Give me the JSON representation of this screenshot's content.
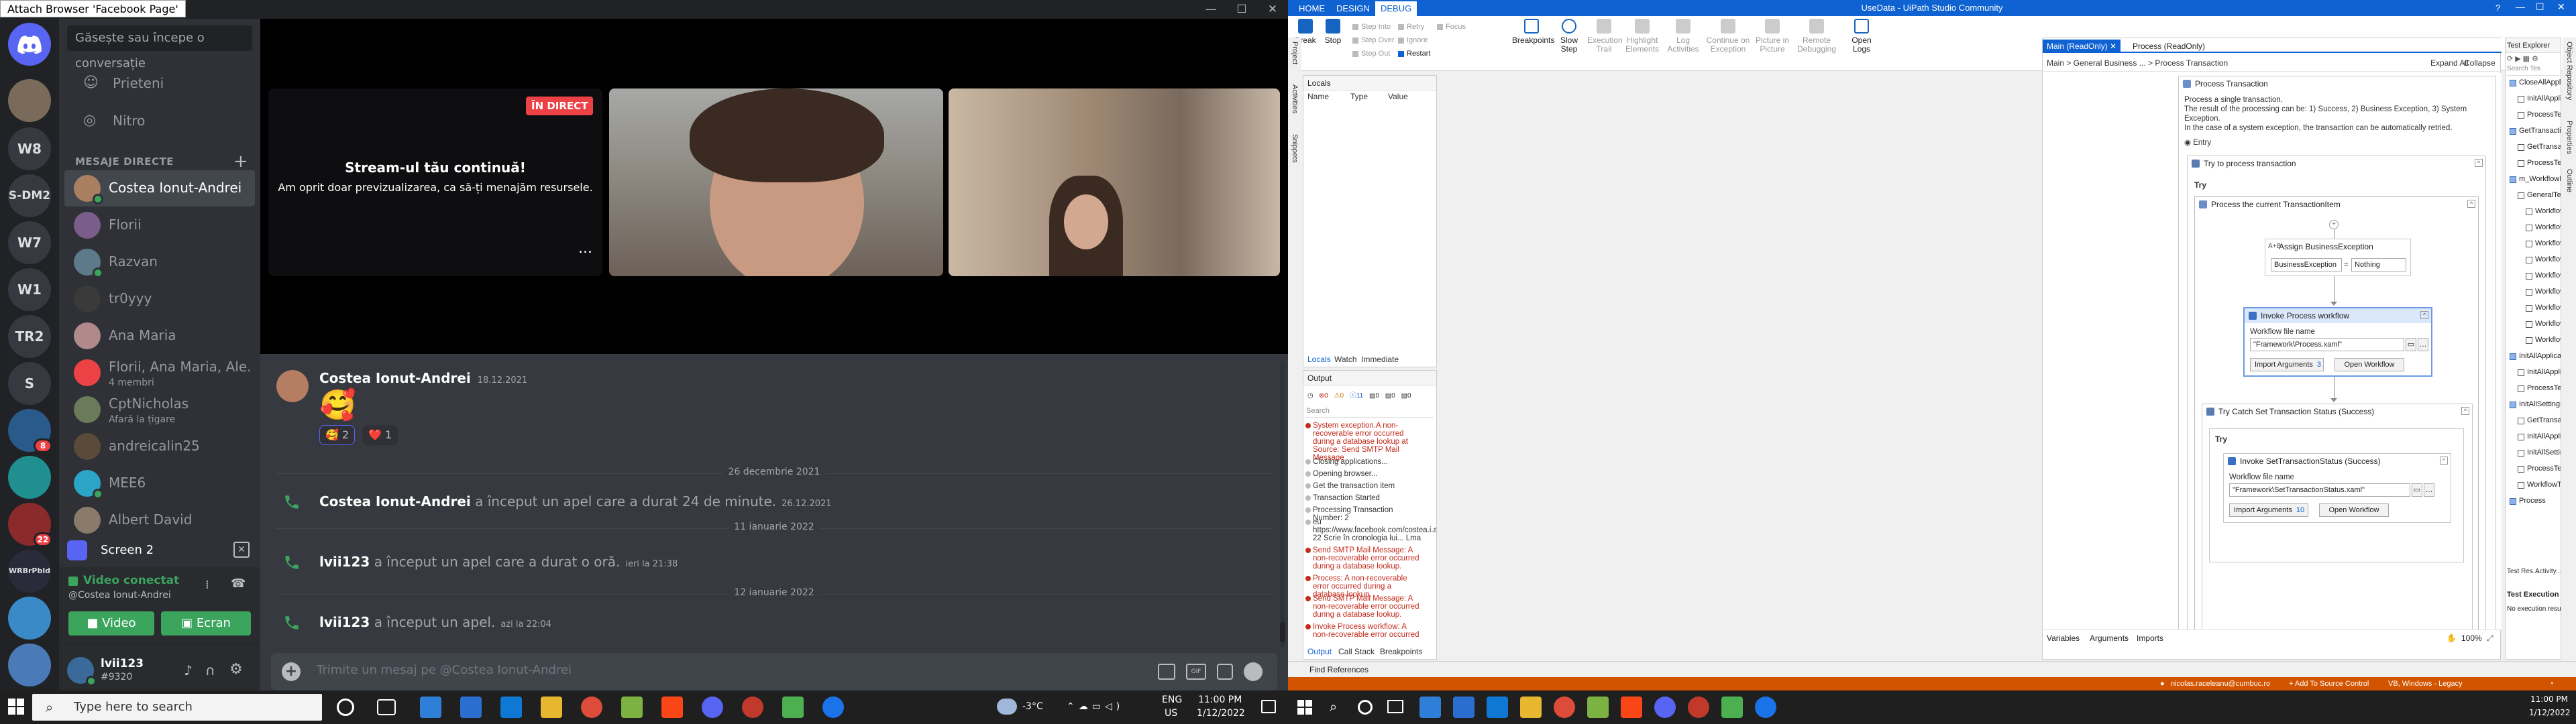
{
  "left_monitor": {
    "attach_badge": "Attach Browser 'Facebook Page'",
    "guilds": [
      {
        "label": "",
        "icon": "discord-logo-icon"
      },
      {
        "label": "",
        "icon": "server-avatar"
      },
      {
        "label": "W8"
      },
      {
        "label": "S-DM2"
      },
      {
        "label": "W7"
      },
      {
        "label": "W1"
      },
      {
        "label": "TR2"
      },
      {
        "label": "S"
      },
      {
        "label": "",
        "badge": "8"
      },
      {
        "label": "",
        "icon": "server-avatar"
      },
      {
        "label": "",
        "badge": "22"
      },
      {
        "label": "WRBrPbld"
      },
      {
        "label": "",
        "icon": "server-avatar"
      },
      {
        "label": "",
        "icon": "server-avatar"
      }
    ],
    "search_placeholder": "Găsește sau începe o conversație",
    "nav": {
      "friends": "Prieteni",
      "nitro": "Nitro"
    },
    "dm_header": "MESAJE DIRECTE",
    "dms": [
      {
        "name": "Costea Ionut-Andrei",
        "sub": "",
        "active": true,
        "color": "#a97f61"
      },
      {
        "name": "Florii",
        "sub": "",
        "color": "#7a5d8a"
      },
      {
        "name": "Razvan",
        "sub": "",
        "color": "#5c7a8a"
      },
      {
        "name": "tr0yyy",
        "sub": "",
        "color": "#3a3a3a"
      },
      {
        "name": "Ana Maria",
        "sub": "",
        "color": "#b08a8a"
      },
      {
        "name": "Florii, Ana Maria, Ale...",
        "sub": "4 membri",
        "color": "#ed4245"
      },
      {
        "name": "CptNicholas",
        "sub": "Afară la țigare",
        "color": "#6b7a5a"
      },
      {
        "name": "andreicalin25",
        "sub": "",
        "color": "#5a4a3a"
      },
      {
        "name": "MEE6",
        "sub": "",
        "color": "#2aa5c7"
      },
      {
        "name": "Albert David",
        "sub": "",
        "color": "#8a7a6a"
      }
    ],
    "screen_share_label": "Screen 2",
    "voice": {
      "status": "Video conectat",
      "channel": "@Costea Ionut-Andrei",
      "video_btn": "Video",
      "screen_btn": "Ecran"
    },
    "user": {
      "name": "lvii123",
      "tag": "#9320"
    },
    "stream": {
      "live": "ÎN DIRECT",
      "title": "Stream-ul tău continuă!",
      "subtitle": "Am oprit doar previzualizarea, ca să-ți menajăm resursele.",
      "more": "..."
    },
    "messages": {
      "m1_author": "Costea Ionut-Andrei",
      "m1_time": "18.12.2021",
      "m1_emoji": "🥰",
      "reaction1": "🥰 2",
      "reaction2": "❤️ 1",
      "divider1": "26 decembrie 2021",
      "call1_author": "Costea Ionut-Andrei",
      "call1_text": " a început un apel care a durat 24 de minute.",
      "call1_time": "26.12.2021",
      "divider2": "11 ianuarie 2022",
      "call2_author": "lvii123",
      "call2_text": " a început un apel care a durat o oră.",
      "call2_time": "ieri la 21:38",
      "divider3": "12 ianuarie 2022",
      "call3_author": "lvii123",
      "call3_text": " a început un apel.",
      "call3_time": "azi la 22:04"
    },
    "composer_placeholder": "Trimite un mesaj pe @Costea Ionut-Andrei",
    "taskbar": {
      "search": "Type here to search",
      "weather": "-3°C",
      "lang": "ENG",
      "layout": "US",
      "time": "11:00 PM",
      "date": "1/12/2022"
    }
  },
  "right_monitor": {
    "title": "UseData - UiPath Studio Community",
    "menu_tabs": [
      "HOME",
      "DESIGN",
      "DEBUG"
    ],
    "ribbon": {
      "break": "Break",
      "stop": "Stop",
      "step_into": "Step Into",
      "step_over": "Step Over",
      "step_out": "Step Out",
      "retry": "Retry",
      "ignore": "Ignore",
      "restart": "Restart",
      "focus": "Focus",
      "breakpoints": "Breakpoints",
      "slow_step": "Slow Step",
      "execution_trail": "Execution Trail",
      "highlight_elements": "Highlight Elements",
      "log_activities": "Log Activities",
      "continue_on_exception": "Continue on Exception",
      "picture_in_picture": "Picture in Picture",
      "remote_debugging": "Remote Debugging",
      "open_logs": "Open Logs"
    },
    "left_vtabs": [
      "Project",
      "Activities",
      "Snippets"
    ],
    "locals": {
      "title": "Locals",
      "cols": [
        "Name",
        "Type",
        "Value"
      ],
      "tabs": [
        "Locals",
        "Watch",
        "Immediate"
      ]
    },
    "output": {
      "title": "Output",
      "counts": [
        "0",
        "0",
        "11",
        "0",
        "0",
        "0"
      ],
      "search": "Search",
      "lines": [
        {
          "t": "System exception.A non-recoverable error occurred during a database lookup at Source: Send SMTP Mail Message",
          "err": true
        },
        {
          "t": "Closing applications...",
          "err": false
        },
        {
          "t": "Opening browser...",
          "err": false
        },
        {
          "t": "Get the transaction item",
          "err": false
        },
        {
          "t": "Transaction Started",
          "err": false
        },
        {
          "t": "Processing Transaction Number: 2",
          "err": false
        },
        {
          "t": "eu https://www.facebook.com/costea.i.andrei 22 Scrie în cronologia lui... Lma",
          "err": false
        },
        {
          "t": "Send SMTP Mail Message: A non-recoverable error occurred during a database lookup.",
          "err": true
        },
        {
          "t": "Process: A non-recoverable error occurred during a database lookup.",
          "err": true
        },
        {
          "t": "Send SMTP Mail Message: A non-recoverable error occurred during a database lookup.",
          "err": true
        },
        {
          "t": "Invoke Process workflow: A non-recoverable error occurred during a database lookup.",
          "err": true
        }
      ],
      "tabs": [
        "Output",
        "Call Stack",
        "Breakpoints"
      ]
    },
    "designer": {
      "tabs": [
        "Main (ReadOnly)",
        "Process (ReadOnly)"
      ],
      "crumb": "Main  >  General Business ...  >  Process Transaction",
      "expand_all": "Expand All",
      "collapse_all": "Collapse All",
      "seq_title": "Process Transaction",
      "annotation": [
        "Process a single transaction.",
        "The result of the processing can be: 1) Success, 2) Business Exception, 3) System Exception.",
        "In the case of a system exception, the transaction can be automatically retried."
      ],
      "entry": "Entry",
      "try_catch": "Try to process transaction",
      "try": "Try",
      "seq_current": "Process the current TransactionItem",
      "assign_title": "Assign BusinessException",
      "assign_left": "BusinessException",
      "assign_right": "Nothing",
      "invoke1_title": "Invoke Process workflow",
      "wf_label": "Workflow file name",
      "invoke1_path": "\"Framework\\Process.xaml\"",
      "import_args": "Import Arguments",
      "import1_count": "3",
      "open_wf": "Open Workflow",
      "try_catch2": "Try Catch Set Transaction Status (Success)",
      "try2": "Try",
      "invoke2_title": "Invoke SetTransactionStatus (Success)",
      "invoke2_path": "\"Framework\\SetTransactionStatus.xaml\"",
      "import2_count": "10",
      "bottom_tabs": [
        "Variables",
        "Arguments",
        "Imports"
      ],
      "zoom": "100%"
    },
    "test_explorer": {
      "title": "Test Explorer",
      "search": "Search Tes",
      "items": [
        {
          "t": "CloseAllApplications",
          "lvl": 0,
          "grp": true
        },
        {
          "t": "InitAllApplications",
          "lvl": 1
        },
        {
          "t": "ProcessTestCase",
          "lvl": 1
        },
        {
          "t": "GetTransactionData",
          "lvl": 0,
          "grp": true
        },
        {
          "t": "GetTransactionDa",
          "lvl": 1
        },
        {
          "t": "ProcessTestCase",
          "lvl": 1
        },
        {
          "t": "m_WorkflowFile",
          "lvl": 0,
          "grp": true
        },
        {
          "t": "GeneralTestCase",
          "lvl": 1
        },
        {
          "t": "WorkflowFile",
          "lvl": 2
        },
        {
          "t": "WorkflowFile",
          "lvl": 2
        },
        {
          "t": "WorkflowFile",
          "lvl": 2
        },
        {
          "t": "WorkflowFile",
          "lvl": 2
        },
        {
          "t": "WorkflowFile",
          "lvl": 2
        },
        {
          "t": "WorkflowFile",
          "lvl": 2
        },
        {
          "t": "WorkflowFile",
          "lvl": 2
        },
        {
          "t": "WorkflowFile",
          "lvl": 2
        },
        {
          "t": "WorkflowFile",
          "lvl": 2
        },
        {
          "t": "InitAllApplications",
          "lvl": 0,
          "grp": true
        },
        {
          "t": "InitAllApplications",
          "lvl": 1
        },
        {
          "t": "ProcessTestCase",
          "lvl": 1
        },
        {
          "t": "InitAllSettings",
          "lvl": 0,
          "grp": true
        },
        {
          "t": "GetTransactionDa",
          "lvl": 1
        },
        {
          "t": "InitAllApplications",
          "lvl": 1
        },
        {
          "t": "InitAllSettingsTest",
          "lvl": 1
        },
        {
          "t": "ProcessTestCase",
          "lvl": 1
        },
        {
          "t": "WorkflowTestCase",
          "lvl": 1
        },
        {
          "t": "Process",
          "lvl": 0,
          "grp": true
        }
      ],
      "bottom_tabs": [
        "Test Res...",
        "Activity..."
      ],
      "results_title": "Test Execution Results",
      "results_text": "No execution results availab"
    },
    "right_vtabs": [
      "Object Repository",
      "Properties",
      "Outline"
    ],
    "find_refs": "Find References",
    "status": {
      "user": "nicolas.raceleanu@cumbuc.ro",
      "source_control": "+ Add To Source Control",
      "env": "VB, Windows - Legacy"
    },
    "taskbar": {
      "time": "11:00 PM",
      "date": "1/12/2022"
    }
  }
}
